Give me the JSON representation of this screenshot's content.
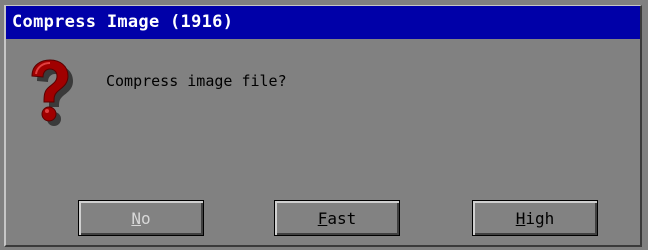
{
  "dialog": {
    "title": "Compress Image (1916)",
    "message": "Compress image file?",
    "icon": "question-mark-icon"
  },
  "buttons": {
    "no": "No",
    "fast": "Fast",
    "high": "High"
  },
  "colors": {
    "titlebar": "#0000a8",
    "dialog_bg": "#818181",
    "icon_red": "#a00000"
  }
}
